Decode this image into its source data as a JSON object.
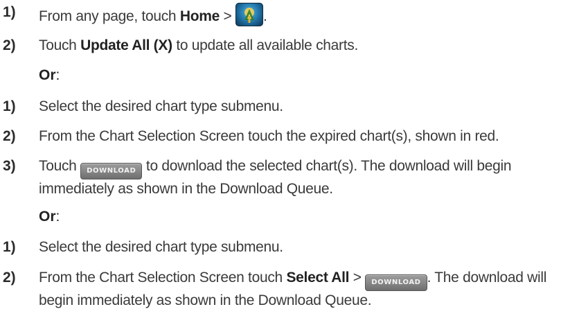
{
  "sections": [
    {
      "steps": [
        {
          "num": "1)",
          "pre": "From any page, touch ",
          "bold": "Home",
          "post": " > ",
          "icon": "charts-app-icon",
          "tail": "."
        },
        {
          "num": "2)",
          "pre": "Touch ",
          "bold": "Update All (X)",
          "post": " to update all available charts."
        }
      ],
      "or_label": "Or",
      "or_colon": ":"
    },
    {
      "steps": [
        {
          "num": "1)",
          "text": "Select the desired chart type submenu."
        },
        {
          "num": "2)",
          "text": "From the Chart Selection Screen touch the expired chart(s), shown in red."
        },
        {
          "num": "3)",
          "pre": "Touch ",
          "button": "DOWNLOAD",
          "post": " to download the selected chart(s). The download will begin immediately as shown in the Download Queue."
        }
      ],
      "or_label": "Or",
      "or_colon": ":"
    },
    {
      "steps": [
        {
          "num": "1)",
          "text": "Select the desired chart type submenu."
        },
        {
          "num": "2)",
          "pre": "From the Chart Selection Screen touch ",
          "bold": "Select All",
          "mid": " > ",
          "button": "DOWNLOAD",
          "post": ".  The download will begin immediately as shown in the Download Queue."
        }
      ]
    }
  ],
  "colors": {
    "text": "#3a3a3a",
    "button_bg": "#8a8a8a",
    "icon_blue": "#1f6fa3"
  }
}
